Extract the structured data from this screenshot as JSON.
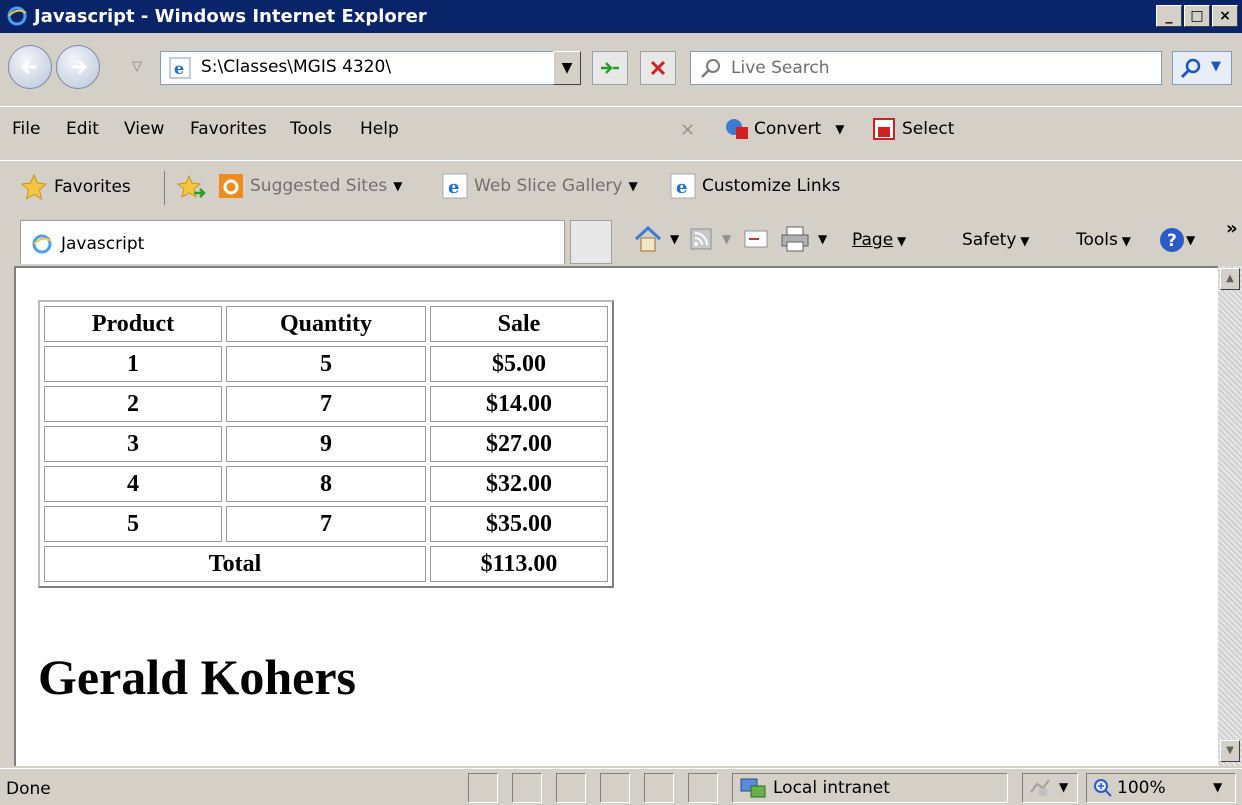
{
  "window": {
    "title": "Javascript - Windows Internet Explorer"
  },
  "address_bar": {
    "url": "S:\\Classes\\MGIS 4320\\"
  },
  "search": {
    "placeholder": "Live Search"
  },
  "menu": {
    "items": [
      "File",
      "Edit",
      "View",
      "Favorites",
      "Tools",
      "Help"
    ]
  },
  "toolbar_addons": {
    "convert_label": "Convert",
    "select_label": "Select"
  },
  "favorites_bar": {
    "favorites_label": "Favorites",
    "suggested_sites_label": "Suggested Sites",
    "web_slice_label": "Web Slice Gallery",
    "customize_links_label": "Customize Links"
  },
  "tab": {
    "title": "Javascript"
  },
  "command_bar": {
    "page_label": "Page",
    "safety_label": "Safety",
    "tools_label": "Tools"
  },
  "content": {
    "table": {
      "headers": [
        "Product",
        "Quantity",
        "Sale"
      ],
      "rows": [
        [
          "1",
          "5",
          "$5.00"
        ],
        [
          "2",
          "7",
          "$14.00"
        ],
        [
          "3",
          "9",
          "$27.00"
        ],
        [
          "4",
          "8",
          "$32.00"
        ],
        [
          "5",
          "7",
          "$35.00"
        ]
      ],
      "total_label": "Total",
      "total_value": "$113.00"
    },
    "heading": "Gerald Kohers"
  },
  "status_bar": {
    "status": "Done",
    "zone": "Local intranet",
    "zoom": "100%"
  }
}
